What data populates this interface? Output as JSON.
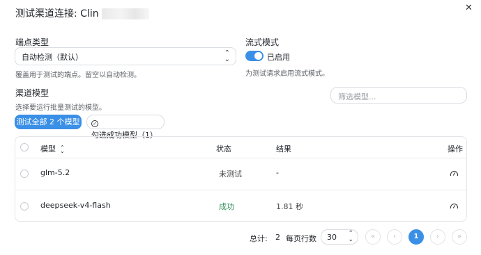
{
  "dialog": {
    "title": "测试渠道连接: Clin",
    "close_icon": "close-icon"
  },
  "endpoint": {
    "label": "端点类型",
    "value": "自动检测（默认）",
    "hint": "覆盖用于测试的端点。留空以自动检测。"
  },
  "stream": {
    "label": "流式模式",
    "toggle_on": true,
    "toggle_label": "已启用",
    "hint": "为测试请求启用流式模式。"
  },
  "models_section": {
    "label": "渠道模型",
    "hint": "选择要运行批量测试的模型。",
    "filter_placeholder": "筛选模型...",
    "test_all_button": "测试全部 2 个模型",
    "select_success_button": "勾选成功模型（1）"
  },
  "table": {
    "headers": {
      "model": "模型",
      "status": "状态",
      "result": "结果",
      "actions": "操作"
    },
    "rows": [
      {
        "model": "glm-5.2",
        "status": "未测试",
        "result": "-"
      },
      {
        "model": "deepseek-v4-flash",
        "status": "成功",
        "result": "1.81 秒"
      }
    ]
  },
  "pagination": {
    "total_label": "总计:",
    "total": "2",
    "per_page_label": "每页行数",
    "per_page": "30",
    "current_page": "1"
  },
  "colors": {
    "accent": "#3a8fe6",
    "success": "#2e8b57"
  }
}
